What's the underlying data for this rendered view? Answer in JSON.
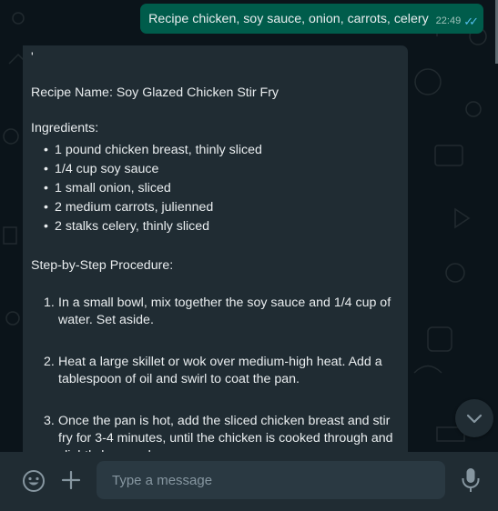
{
  "sent_message": {
    "text": "Recipe chicken, soy sauce, onion, carrots, celery",
    "time": "22:49",
    "ticks_icon": "double-check-icon"
  },
  "received_message": {
    "apostrophe": "'",
    "recipe_name": "Recipe Name: Soy Glazed Chicken Stir Fry",
    "ingredients_heading": "Ingredients:",
    "ingredients": [
      "1 pound chicken breast, thinly sliced",
      "1/4 cup soy sauce",
      "1 small onion, sliced",
      "2 medium carrots, julienned",
      "2 stalks celery, thinly sliced"
    ],
    "bullet": "•",
    "procedure_heading": "Step-by-Step Procedure:",
    "steps": [
      {
        "num": "1.",
        "text": "In a small bowl, mix together the soy sauce and 1/4 cup of water. Set aside."
      },
      {
        "num": "2.",
        "text": "Heat a large skillet or wok over medium-high heat. Add a tablespoon of oil and swirl to coat the pan."
      },
      {
        "num": "3.",
        "text": "Once the pan is hot, add the sliced chicken breast and stir fry for 3-4 minutes, until the chicken is cooked through and slightly browned."
      }
    ]
  },
  "composer": {
    "placeholder": "Type a message",
    "emoji_icon": "emoji-icon",
    "attach_icon": "plus-icon",
    "mic_icon": "microphone-icon"
  },
  "scroll_button_icon": "chevron-down-icon",
  "colors": {
    "background": "#0b141a",
    "sent_bubble": "#005c4b",
    "received_bubble": "#202c33",
    "input": "#2a3942",
    "ticks": "#53bdeb"
  }
}
